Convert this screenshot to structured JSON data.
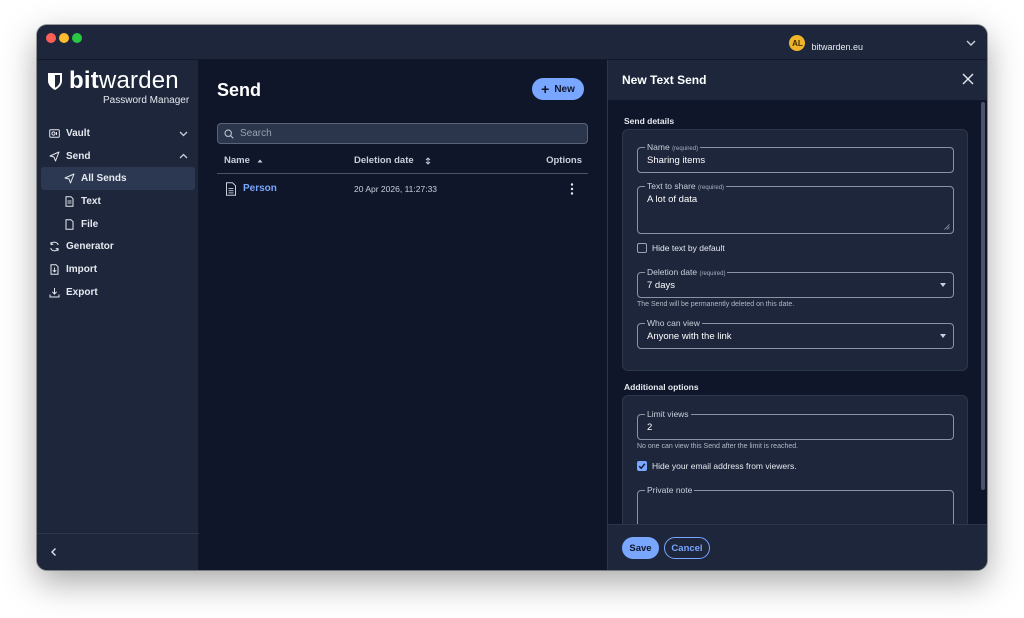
{
  "account": {
    "initials": "AL",
    "server": "bitwarden.eu"
  },
  "sidebar": {
    "brand_bold": "bit",
    "brand_rest": "warden",
    "brand_sub": "Password Manager",
    "items": [
      {
        "label": "Vault",
        "icon": "vault-icon"
      },
      {
        "label": "Send",
        "icon": "send-icon"
      },
      {
        "label": "All Sends",
        "icon": "send-icon"
      },
      {
        "label": "Text",
        "icon": "text-file-icon"
      },
      {
        "label": "File",
        "icon": "file-icon"
      },
      {
        "label": "Generator",
        "icon": "generator-icon"
      },
      {
        "label": "Import",
        "icon": "import-icon"
      },
      {
        "label": "Export",
        "icon": "export-icon"
      }
    ]
  },
  "main": {
    "title": "Send",
    "new_label": "New",
    "search_placeholder": "Search",
    "table": {
      "columns": [
        "Name",
        "Deletion date",
        "Options"
      ],
      "rows": [
        {
          "name": "Person",
          "deletion_date": "20 Apr 2026, 11:27:33"
        }
      ]
    }
  },
  "dialog": {
    "title": "New Text Send",
    "send_details_title": "Send details",
    "required_tag": "(required)",
    "name_label": "Name",
    "name_value": "Sharing items",
    "text_label": "Text to share",
    "text_value": "A lot of data",
    "hide_text_label": "Hide text by default",
    "deletion_label": "Deletion date",
    "deletion_value": "7 days",
    "deletion_hint": "The Send will be permanently deleted on this date.",
    "who_label": "Who can view",
    "who_value": "Anyone with the link",
    "additional_title": "Additional options",
    "limit_label": "Limit views",
    "limit_value": "2",
    "limit_hint": "No one can view this Send after the limit is reached.",
    "hide_email_label": "Hide your email address from viewers.",
    "private_note_label": "Private note",
    "save_label": "Save",
    "cancel_label": "Cancel"
  },
  "colors": {
    "accent": "#79a6ff",
    "background": "#0f1629",
    "surface": "#1d263b"
  }
}
